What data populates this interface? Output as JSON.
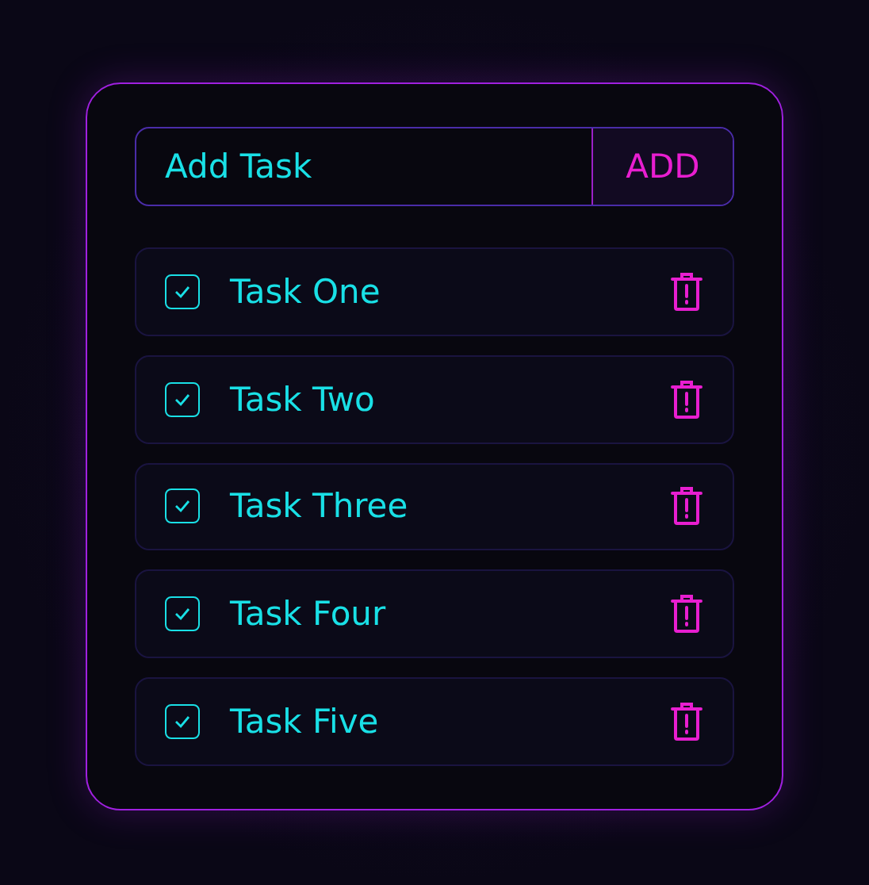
{
  "new_task": {
    "placeholder": "Add Task",
    "button": "ADD"
  },
  "tasks": [
    {
      "label": "Task One",
      "checked": true
    },
    {
      "label": "Task Two",
      "checked": true
    },
    {
      "label": "Task Three",
      "checked": true
    },
    {
      "label": "Task Four",
      "checked": true
    },
    {
      "label": "Task Five",
      "checked": true
    }
  ]
}
